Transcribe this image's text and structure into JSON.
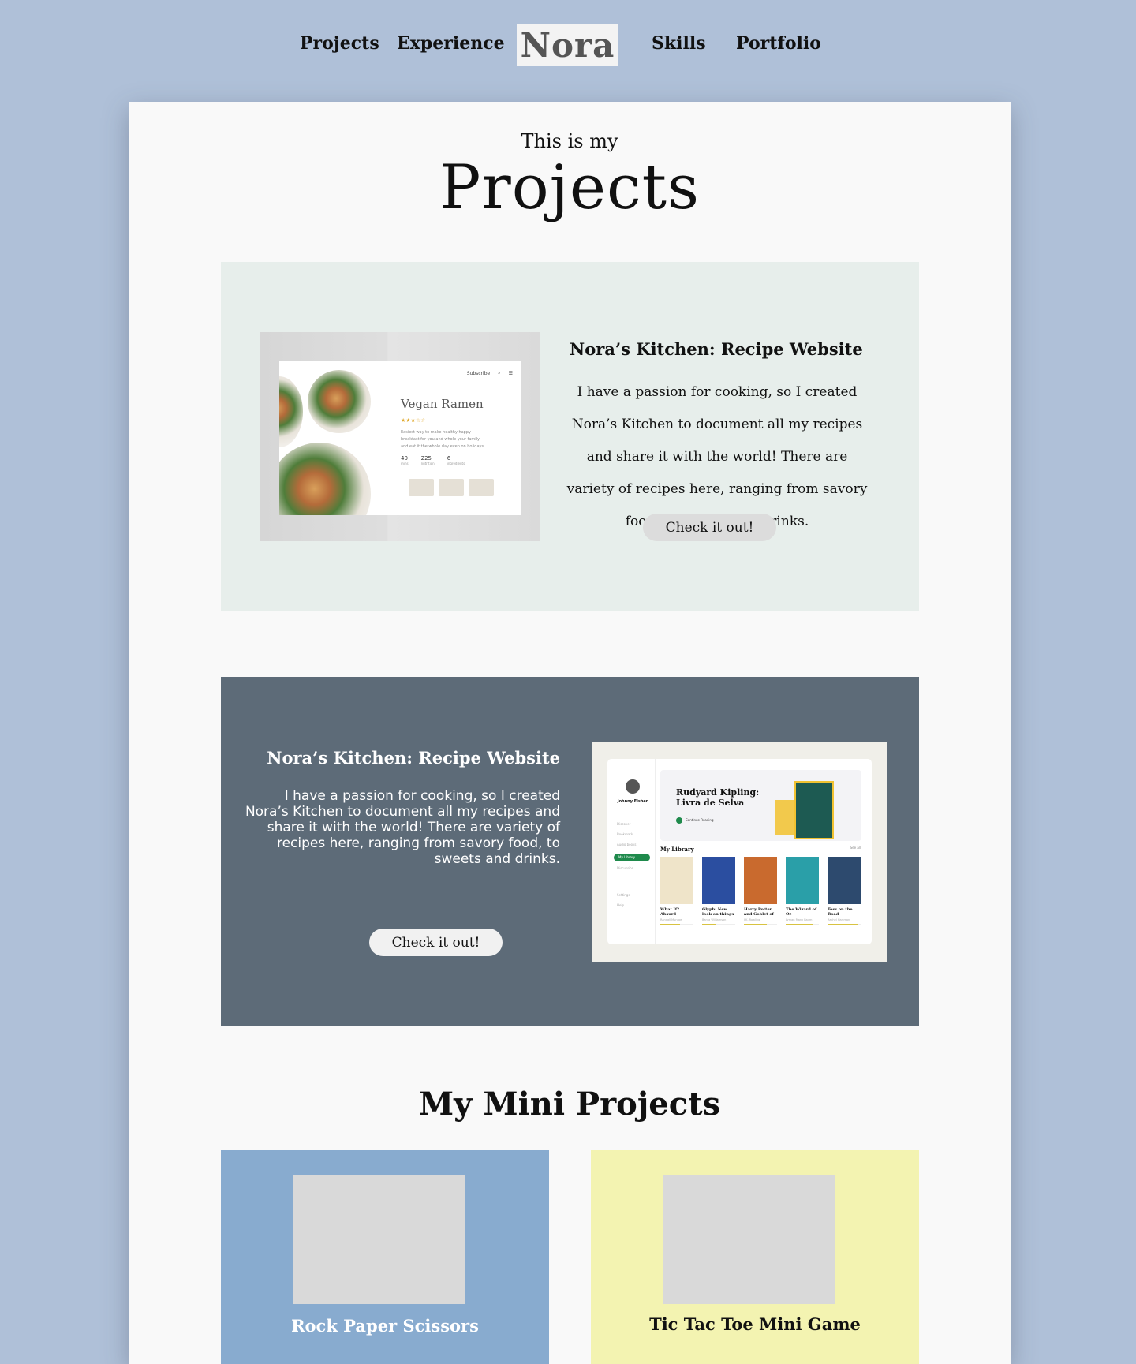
{
  "nav": {
    "links": [
      "Projects",
      "Experience",
      "Skills",
      "Portfolio"
    ],
    "logo": "Nora"
  },
  "intro": {
    "subtitle": "This is my",
    "title": "Projects"
  },
  "projects": [
    {
      "title": "Nora’s Kitchen: Recipe Website",
      "description": "I have a passion for cooking, so I created Nora’s Kitchen to document all my recipes and share it with the world! There are variety of recipes here, ranging from savory food, to sweets and drinks.",
      "button": "Check it out!",
      "background": "#e7eeeb",
      "mockup": {
        "subscribe": "Subscribe",
        "dish": "Vegan Ramen",
        "rating_stars": "★★★☆☆",
        "blurb": "Easiest way to make healthy happy breakfast for you and whole your family and eat it the whole day even on holidays",
        "stats": [
          {
            "value": "40",
            "label": "mins"
          },
          {
            "value": "225",
            "label": "nutrition"
          },
          {
            "value": "6",
            "label": "ingredients"
          }
        ]
      }
    },
    {
      "title": "Nora’s Kitchen: Recipe Website",
      "description": "I have a passion for cooking, so I created Nora’s Kitchen to document all my recipes and share it with the world! There are variety of recipes here, ranging from savory food, to sweets and drinks.",
      "button": "Check it out!",
      "background": "#5d6b78",
      "mockup": {
        "user": "Johnny Fisher",
        "menu": [
          "Discover",
          "Bookmark",
          "Audio books",
          "My Library",
          "Discussion",
          "Settings",
          "Help"
        ],
        "banner_title": "Rudyard Kipling: Livra de Selva",
        "banner_action": "Continue Reading",
        "library_title": "My Library",
        "see_all": "See all",
        "books": [
          {
            "title": "What If? Absurd Questions",
            "author": "Randall Munroe",
            "color": "#efe4c9",
            "progress": 0.6
          },
          {
            "title": "Glyph: New look on things",
            "author": "Banta Williamson",
            "color": "#2b4ea0",
            "progress": 0.4
          },
          {
            "title": "Harry Potter and Goblet of fire",
            "author": "J.K. Rowling",
            "color": "#c96a2e",
            "progress": 0.7
          },
          {
            "title": "The Wizard of Oz",
            "author": "Lyman Frank Baum",
            "color": "#2a9fa8",
            "progress": 0.8
          },
          {
            "title": "Tess on the Road",
            "author": "Rachel Hartman",
            "color": "#2d4a6e",
            "progress": 0.9
          }
        ]
      }
    }
  ],
  "mini": {
    "heading": "My Mini Projects",
    "items": [
      {
        "label": "Rock Paper Scissors",
        "background": "#88abcf",
        "text_color": "#ffffff"
      },
      {
        "label": "Tic Tac Toe Mini Game",
        "background": "#f3f3b1",
        "text_color": "#111111"
      }
    ]
  },
  "colors": {
    "page_bg": "#afc0d8",
    "card_bg": "#f9f9f9",
    "button_bg": "#dcdcdc",
    "button_bg_dark": "#f1f1f1"
  }
}
